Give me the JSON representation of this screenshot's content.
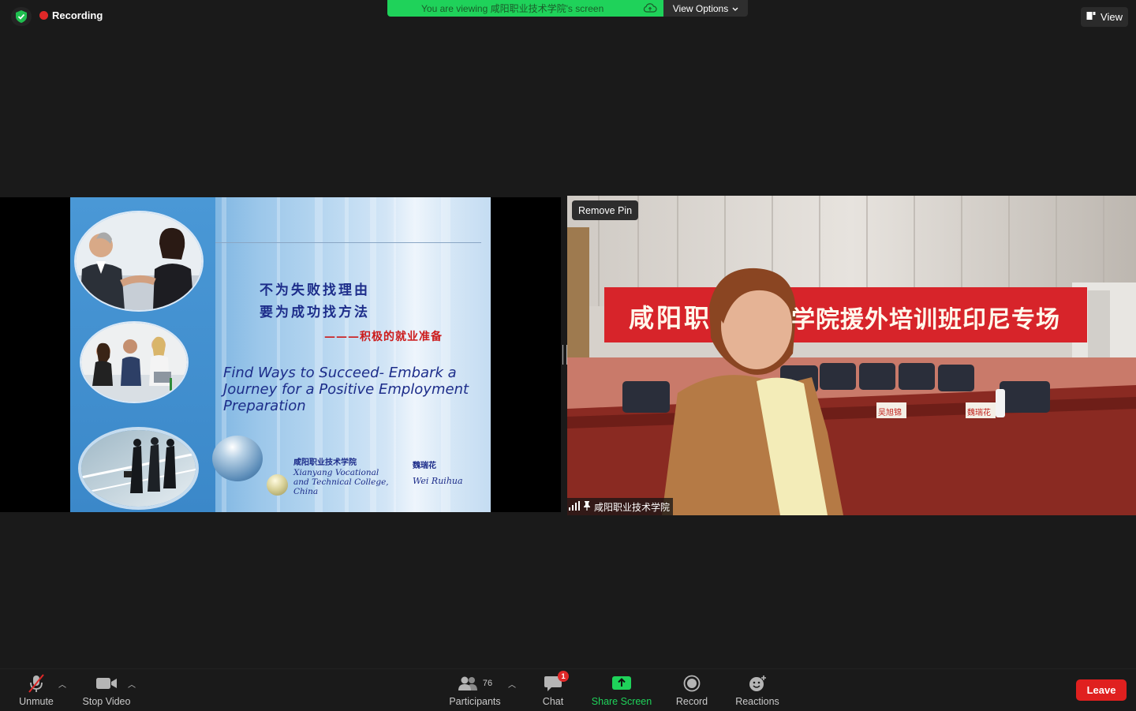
{
  "top_bar": {
    "recording_label": "Recording",
    "banner_text": "You are viewing 咸阳职业技术学院's screen",
    "view_options_label": "View Options",
    "view_label": "View"
  },
  "slide": {
    "cn_line1": "不为失败找理由",
    "cn_line2": "要为成功找方法",
    "cn_line3": "———积极的就业准备",
    "en_title": "Find Ways to Succeed- Embark a Journey for a Positive Employment Preparation",
    "college_cn": "咸阳职业技术学院",
    "college_en": "Xianyang Vocational and Technical College, China",
    "author_cn": "魏瑞花",
    "author_en": "Wei Ruihua"
  },
  "video": {
    "remove_pin_label": "Remove Pin",
    "participant_name": "咸阳职业技术学院",
    "banner_left": "咸阳职",
    "banner_right": "学院援外培训班印尼专场",
    "name_card1": "吴旭锦",
    "name_card2": "魏瑞花"
  },
  "toolbar": {
    "unmute_label": "Unmute",
    "stop_video_label": "Stop Video",
    "participants_label": "Participants",
    "participants_count": "76",
    "chat_label": "Chat",
    "chat_badge": "1",
    "share_screen_label": "Share Screen",
    "record_label": "Record",
    "reactions_label": "Reactions",
    "leave_label": "Leave"
  },
  "colors": {
    "share_green": "#1fd25a",
    "leave_red": "#e0201f",
    "recording_red": "#e02828",
    "background": "#1a1a1a"
  }
}
